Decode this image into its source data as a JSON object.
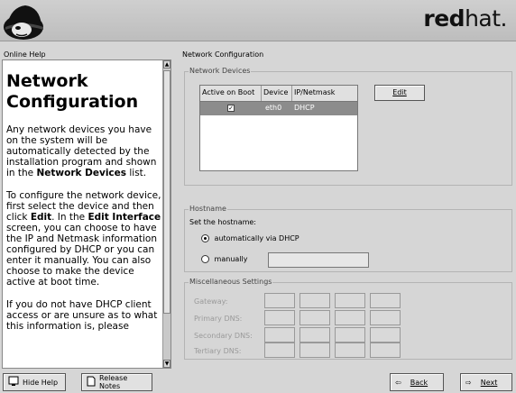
{
  "header": {
    "brand_bold": "red",
    "brand_light": "hat."
  },
  "help": {
    "label": "Online Help",
    "title": "Network Configuration",
    "p1": "Any network devices you have on the system will be automatically detected by the installation program and shown in the ",
    "p1_bold": "Network Devices",
    "p1_end": " list.",
    "p2_a": "To configure the network device, first select the device and then click ",
    "p2_b": "Edit",
    "p2_c": ". In the ",
    "p2_d": "Edit Interface",
    "p2_e": " screen, you can choose to have the IP and Netmask information configured by DHCP or you can enter it manually. You can also choose to make the device active at boot time.",
    "p3": "If you do not have DHCP client access or are unsure as to what this information is, please"
  },
  "main": {
    "title": "Network Configuration",
    "devices": {
      "title": "Network Devices",
      "columns": [
        "Active on Boot",
        "Device",
        "IP/Netmask"
      ],
      "rows": [
        {
          "active": true,
          "device": "eth0",
          "ip": "DHCP"
        }
      ],
      "edit_label": "Edit"
    },
    "hostname": {
      "title": "Hostname",
      "prompt": "Set the hostname:",
      "auto_label": "automatically via DHCP",
      "manual_label": "manually",
      "manual_value": ""
    },
    "misc": {
      "title": "Miscellaneous Settings",
      "labels": [
        "Gateway:",
        "Primary DNS:",
        "Secondary DNS:",
        "Tertiary DNS:"
      ]
    }
  },
  "footer": {
    "hide_help": "Hide Help",
    "release_notes": "Release Notes",
    "back": "Back",
    "next": "Next"
  }
}
